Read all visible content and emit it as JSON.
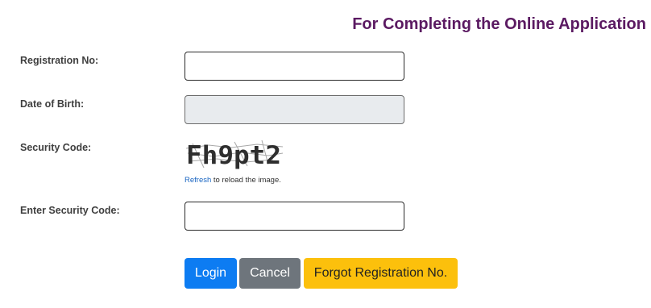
{
  "heading": "For Completing the Online Application",
  "form": {
    "registration_label": "Registration No:",
    "registration_value": "",
    "dob_label": "Date of Birth:",
    "dob_value": "",
    "security_code_label": "Security Code:",
    "captcha_text": "Fh9pt2",
    "refresh_link": "Refresh",
    "refresh_suffix": " to reload the image.",
    "enter_code_label": "Enter Security Code:",
    "enter_code_value": ""
  },
  "buttons": {
    "login": "Login",
    "cancel": "Cancel",
    "forgot": "Forgot Registration No."
  },
  "colors": {
    "heading": "#5b1a62",
    "login": "#0d7cf2",
    "cancel": "#6e757c",
    "forgot": "#fcc00c",
    "link": "#1a66c2"
  }
}
